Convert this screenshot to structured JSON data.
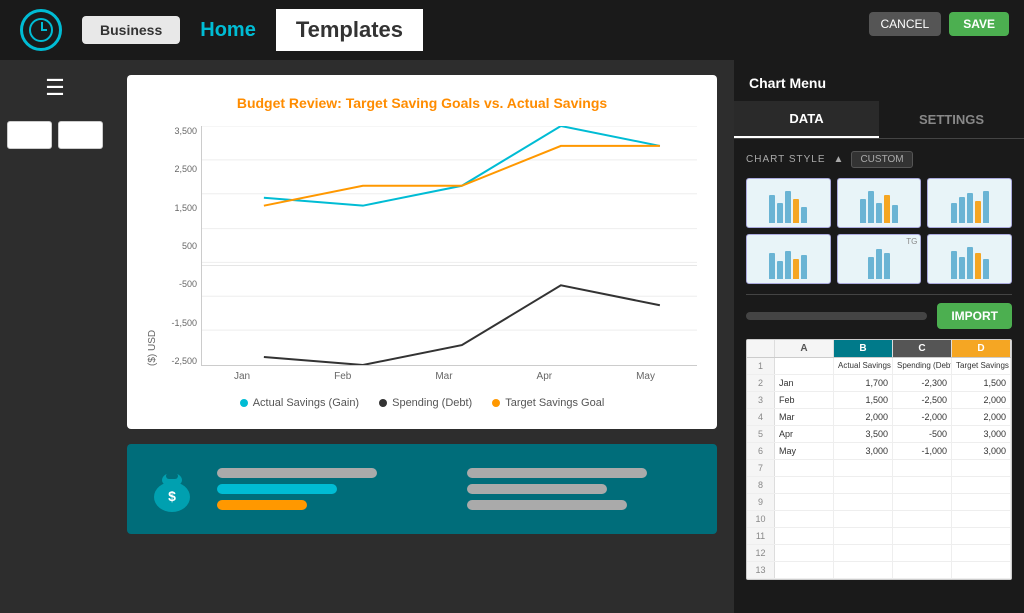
{
  "nav": {
    "business_label": "Business",
    "home_label": "Home",
    "templates_label": "Templates",
    "cancel_label": "CANCEL",
    "save_label": "SAVE"
  },
  "chart_menu": {
    "title": "Chart Menu",
    "tab_data": "DATA",
    "tab_settings": "SETTINGS",
    "chart_style_label": "CHART STYLE",
    "chart_style_arrow": "▲",
    "chart_style_badge": "CUSTOM",
    "import_label": "IMPORT"
  },
  "chart": {
    "title": "Budget Review: Target Saving Goals vs. Actual Savings",
    "y_axis_label": "($) USD",
    "y_ticks": [
      "3,500",
      "2,500",
      "1,500",
      "500",
      "-500",
      "-1,500",
      "-2,500"
    ],
    "x_ticks": [
      "Jan",
      "Feb",
      "Mar",
      "Apr",
      "May"
    ],
    "legend": [
      {
        "label": "Actual Savings (Gain)",
        "color": "#00bcd4"
      },
      {
        "label": "Spending (Debt)",
        "color": "#333"
      },
      {
        "label": "Target Savings Goal",
        "color": "#ff9800"
      }
    ]
  },
  "spreadsheet": {
    "headers": [
      "",
      "A",
      "B",
      "C",
      "D"
    ],
    "col_labels": [
      "B",
      "C",
      "D"
    ],
    "rows": [
      {
        "num": "1",
        "a": "",
        "b": "Actual Savings (Gain)",
        "c": "Spending (Debt)",
        "d": "Target Savings Goal"
      },
      {
        "num": "2",
        "a": "Jan",
        "b": "1,700",
        "c": "-2,300",
        "d": "1,500"
      },
      {
        "num": "3",
        "a": "Feb",
        "b": "1,500",
        "c": "-2,500",
        "d": "2,000"
      },
      {
        "num": "4",
        "a": "Mar",
        "b": "2,000",
        "c": "-2,000",
        "d": "2,000"
      },
      {
        "num": "5",
        "a": "Apr",
        "b": "3,500",
        "c": "-500",
        "d": "3,000"
      },
      {
        "num": "6",
        "a": "May",
        "b": "3,000",
        "c": "-1,000",
        "d": "3,000"
      },
      {
        "num": "7",
        "a": "",
        "b": "",
        "c": "",
        "d": ""
      },
      {
        "num": "8",
        "a": "",
        "b": "",
        "c": "",
        "d": ""
      },
      {
        "num": "9",
        "a": "",
        "b": "",
        "c": "",
        "d": ""
      },
      {
        "num": "10",
        "a": "",
        "b": "",
        "c": "",
        "d": ""
      },
      {
        "num": "11",
        "a": "",
        "b": "",
        "c": "",
        "d": ""
      },
      {
        "num": "12",
        "a": "",
        "b": "",
        "c": "",
        "d": ""
      },
      {
        "num": "13",
        "a": "",
        "b": "",
        "c": "",
        "d": ""
      }
    ]
  }
}
